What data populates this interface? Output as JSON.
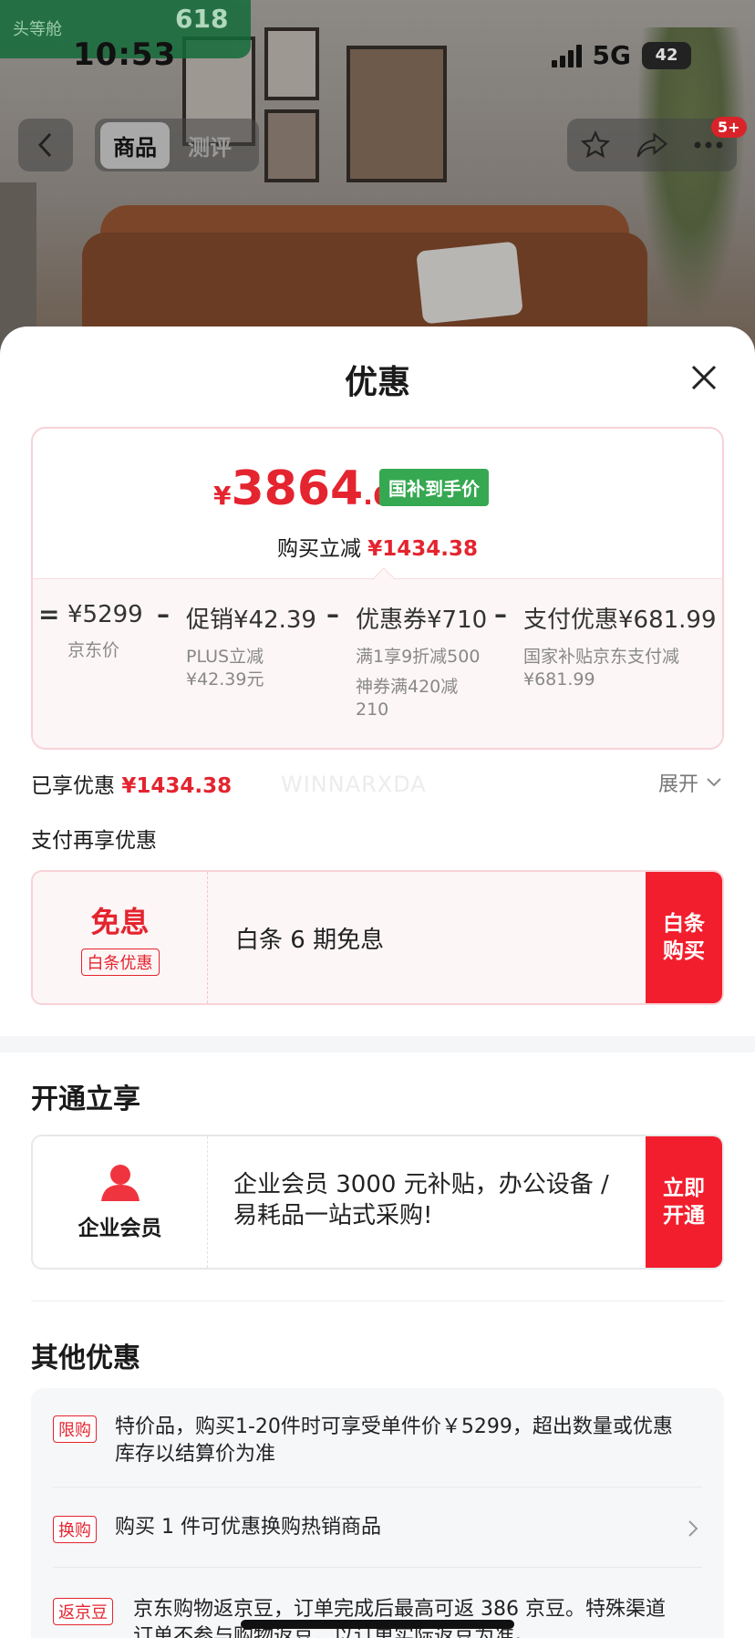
{
  "status_bar": {
    "time": "10:53",
    "network": "5G",
    "battery": "42"
  },
  "top_badge": {
    "text": "头等舱",
    "number": "618"
  },
  "nav": {
    "tabs": [
      {
        "label": "商品",
        "active": true
      },
      {
        "label": "测评",
        "active": false
      }
    ],
    "notification_count": "5+"
  },
  "sheet": {
    "title": "优惠",
    "price_card": {
      "currency": "¥",
      "final_int": "3864",
      "final_dec": ".62",
      "tag": "国补到手价",
      "reduce_label": "购买立减",
      "reduce_amount": "¥1434.38",
      "equals": "=",
      "minus": "–",
      "terms": [
        {
          "value": "¥5299",
          "sub": [
            "京东价"
          ]
        },
        {
          "value": "促销¥42.39",
          "sub": [
            "PLUS立减",
            "¥42.39元"
          ]
        },
        {
          "value": "优惠券¥710",
          "sub": [
            "满1享9折减500",
            "神券满420减",
            "210"
          ]
        },
        {
          "value": "支付优惠¥681.99",
          "sub": [
            "国家补贴京东支付减",
            "¥681.99"
          ]
        }
      ]
    },
    "enjoyed_label": "已享优惠",
    "enjoyed_amount": "¥1434.38",
    "watermark": "WINNARXDA",
    "expand_label": "展开",
    "pay_more_label": "支付再享优惠",
    "baitiao": {
      "big": "免息",
      "tag": "白条优惠",
      "text": "白条 6 期免息",
      "button": "白条购买"
    },
    "open_title": "开通立享",
    "enterprise": {
      "name": "企业会员",
      "text": "企业会员 3000 元补贴，办公设备 / 易耗品一站式采购!",
      "button": "立即开通"
    },
    "other_title": "其他优惠",
    "promos": [
      {
        "tag": "限购",
        "text": "特价品，购买1-20件时可享受单件价￥5299，超出数量或优惠库存以结算价为准",
        "chevron": false
      },
      {
        "tag": "换购",
        "text": "购买 1 件可优惠换购热销商品",
        "chevron": true
      },
      {
        "tag": "返京豆",
        "text": "京东购物返京豆，订单完成后最高可返 386 京豆。特殊渠道订单不参与购物返豆，以订单实际返豆为准。",
        "chevron": false
      }
    ]
  },
  "colors": {
    "accent_red": "#e4242f",
    "button_red": "#f21e2d",
    "gov_green": "#36a852"
  }
}
